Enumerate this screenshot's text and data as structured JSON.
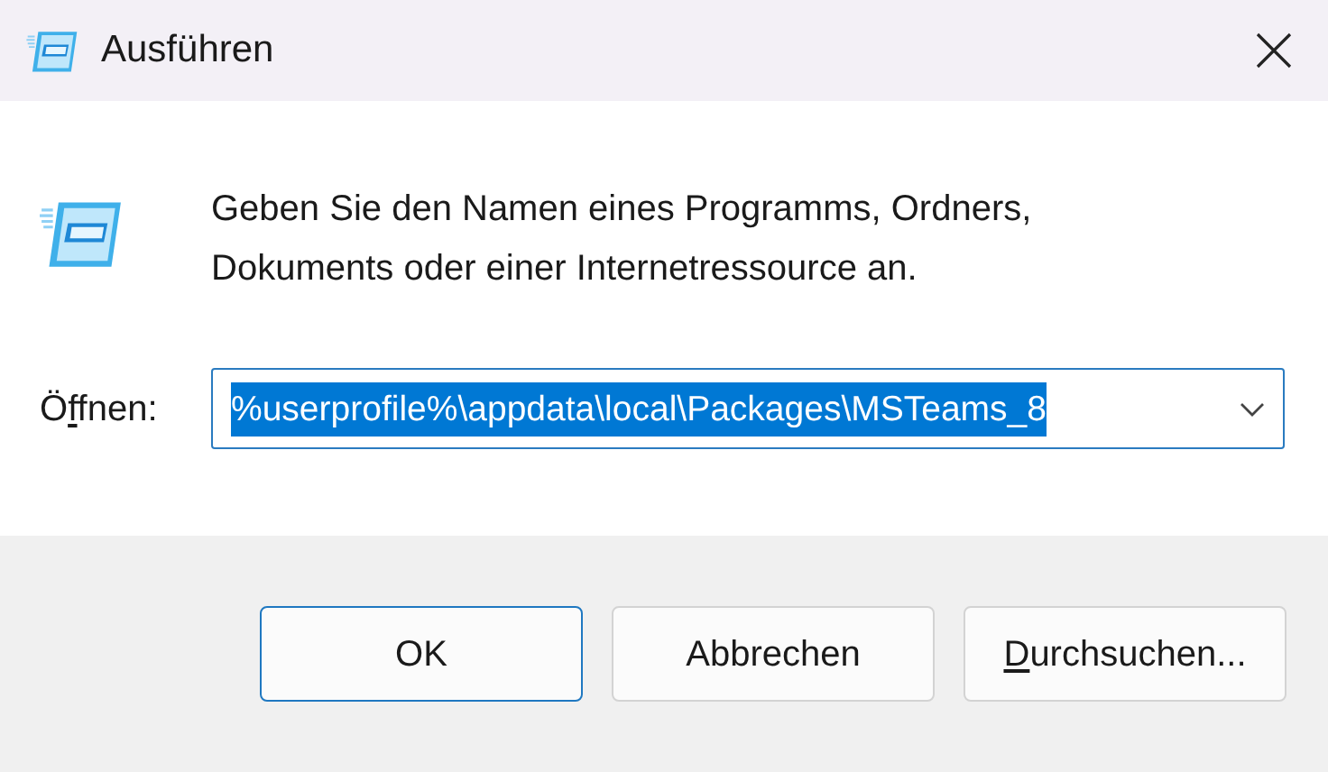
{
  "window": {
    "title": "Ausführen"
  },
  "description": "Geben Sie den Namen eines Programms, Ordners, Dokuments oder einer Internetressource an.",
  "open_field": {
    "label": {
      "before": "Ö",
      "access_key": "f",
      "after": "fnen:"
    },
    "value": "%userprofile%\\appdata\\local\\Packages\\MSTeams_8",
    "selected": true
  },
  "buttons": [
    {
      "label": {
        "after": "OK"
      },
      "default": true
    },
    {
      "label": {
        "after": "Abbrechen"
      },
      "default": false
    },
    {
      "label": {
        "access_key": "D",
        "after": "urchsuchen..."
      },
      "default": false
    }
  ]
}
